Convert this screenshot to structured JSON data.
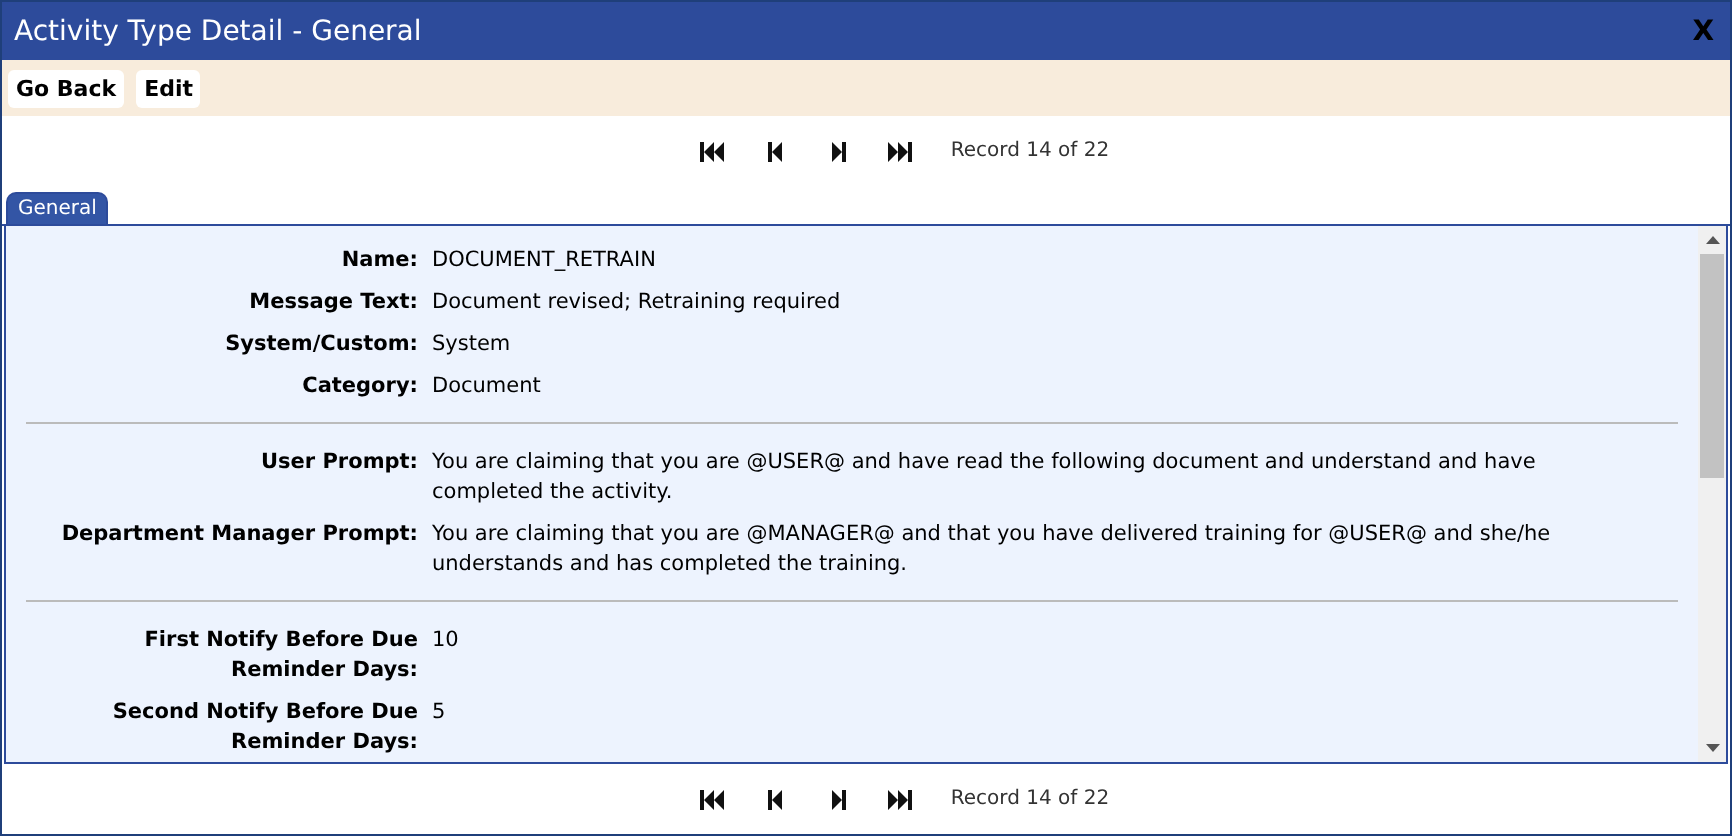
{
  "window": {
    "title": "Activity Type Detail - General",
    "close": "X"
  },
  "toolbar": [
    "Go Back",
    "Edit"
  ],
  "record_nav_top": {
    "text": "Record 14 of 22"
  },
  "tabs": [
    {
      "label": "General",
      "selected": true
    }
  ],
  "sections": [
    [
      {
        "label": "Name:",
        "value": "DOCUMENT_RETRAIN"
      },
      {
        "label": "Message Text:",
        "value": "Document revised; Retraining required"
      },
      {
        "label": "System/Custom:",
        "value": "System"
      },
      {
        "label": "Category:",
        "value": "Document"
      }
    ],
    [
      {
        "label": "User Prompt:",
        "value": "You are claiming that you are @USER@ and have read the following document and understand and have completed the activity."
      },
      {
        "label": "Department Manager Prompt:",
        "value": "You are claiming that you are @MANAGER@ and that you have delivered training for @USER@ and she/he understands and has completed the training."
      }
    ],
    [
      {
        "label": "First Notify Before Due Reminder Days:",
        "value": "10"
      },
      {
        "label": "Second Notify Before Due Reminder Days:",
        "value": "5"
      }
    ]
  ],
  "record_nav_bottom": {
    "text": "Record 14 of 22"
  }
}
